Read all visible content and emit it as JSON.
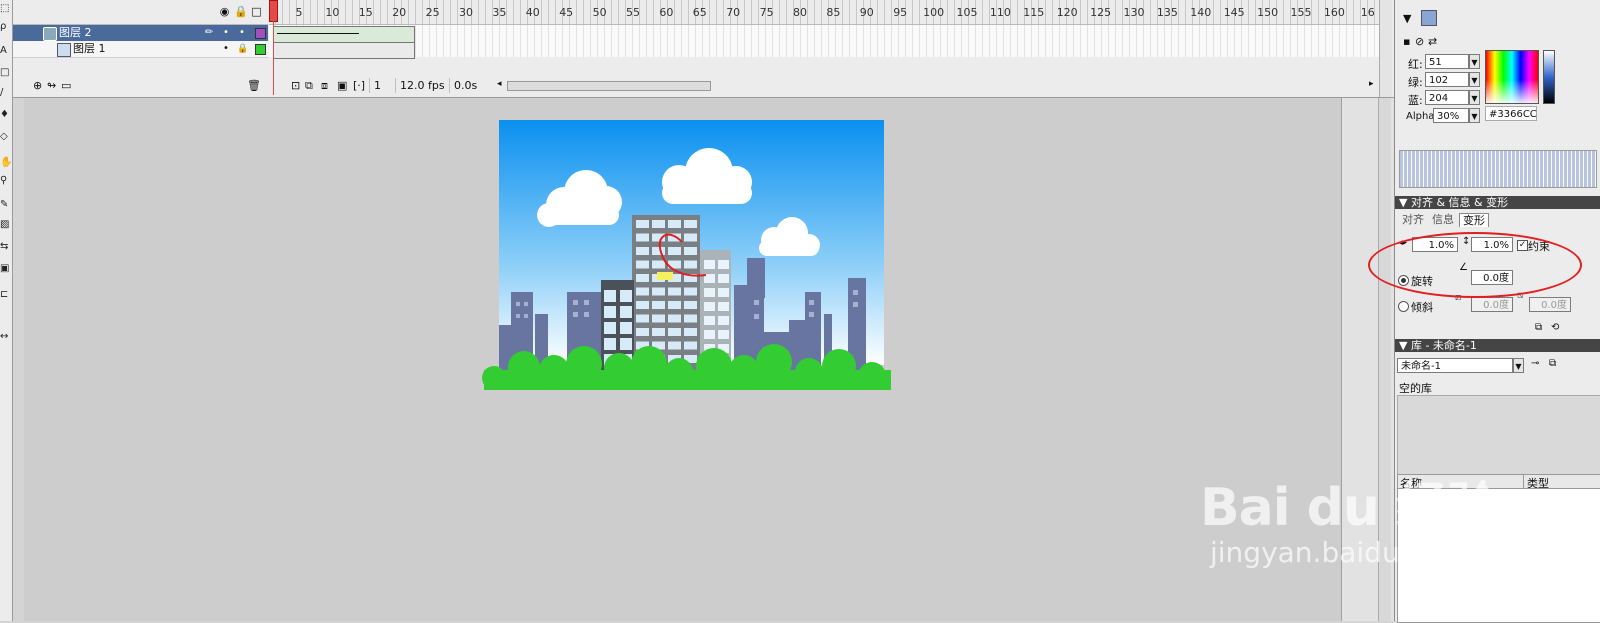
{
  "app": {
    "accent": "#4b6a9c",
    "playhead_color": "#e24b4b"
  },
  "timeline": {
    "ruler_ticks": [
      "5",
      "10",
      "15",
      "20",
      "25",
      "30",
      "35",
      "40",
      "45",
      "50",
      "55",
      "60",
      "65",
      "70",
      "75",
      "80",
      "85",
      "90",
      "95",
      "100",
      "105",
      "110",
      "115",
      "120",
      "125",
      "130",
      "135",
      "140",
      "145",
      "150",
      "155",
      "160",
      "16"
    ],
    "layers": [
      {
        "name": "图层 2",
        "selected": true,
        "color": "#a050c0"
      },
      {
        "name": "图层 1",
        "selected": false,
        "color": "#33cc33"
      }
    ],
    "current_frame": "1",
    "fps": "12.0 fps",
    "time": "0.0s"
  },
  "color_mixer": {
    "red_label": "红:",
    "red_value": "51",
    "green_label": "绿:",
    "green_value": "102",
    "blue_label": "蓝:",
    "blue_value": "204",
    "alpha_label": "Alpha:",
    "alpha_value": "30%",
    "hex_value": "#3366CC"
  },
  "transform_panel": {
    "title": "对齐 & 信息 & 变形",
    "tabs": [
      "对齐",
      "信息",
      "变形"
    ],
    "width_pct": "1.0%",
    "height_pct": "1.0%",
    "constrain_label": "约束",
    "rotate_label": "旋转",
    "rotate_value": "0.0度",
    "skew_label": "倾斜",
    "skew_h": "0.0度",
    "skew_v": "0.0度"
  },
  "library": {
    "title": "库 - 未命名-1",
    "selected_doc": "未命名-1",
    "empty_text": "空的库",
    "col_name": "名称",
    "col_type": "类型"
  },
  "watermark": {
    "brand": "Bai  du 经验",
    "url": "jingyan.baidu.com"
  }
}
